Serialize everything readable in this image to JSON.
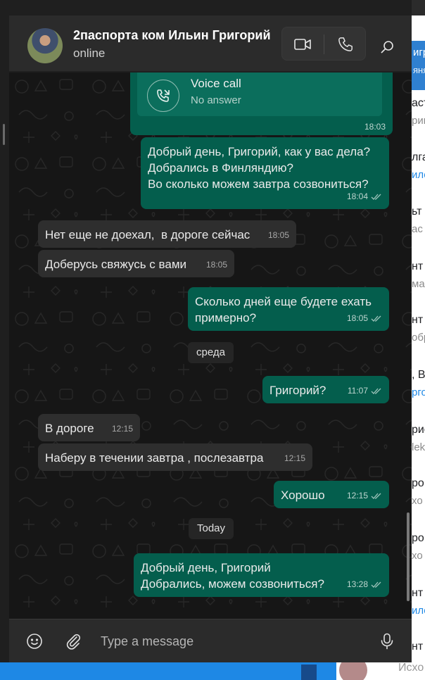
{
  "background_app": {
    "highlight_lines": [
      "игр",
      "яня"
    ],
    "rows": [
      {
        "title": "аст",
        "sub": "рин",
        "sub_blue": false
      },
      {
        "title": "лга",
        "sub": "ило",
        "sub_blue": true
      },
      {
        "title": "ьт",
        "sub": "ас",
        "sub_blue": false
      },
      {
        "title": "нт I",
        "sub": "ма",
        "sub_blue": false
      },
      {
        "title": "нт I",
        "sub": "обр",
        "sub_blue": false
      },
      {
        "title": ", Ві",
        "sub": "рго",
        "sub_blue": true
      },
      {
        "title": "рис",
        "sub": "lek",
        "sub_blue": false
      },
      {
        "title": "ро",
        "sub": "хо",
        "sub_blue": false
      },
      {
        "title": "ро",
        "sub": "хо",
        "sub_blue": false
      },
      {
        "title": "нт I",
        "sub": "ило",
        "sub_blue": true
      },
      {
        "title": "нт I",
        "sub": "",
        "sub_blue": false
      }
    ],
    "bottom_item_text": "Исхо"
  },
  "header": {
    "contact_name": "2паспорта ком Ильин Григорий",
    "status": "online",
    "icons": {
      "video": "video-call-icon",
      "voice": "phone-icon",
      "search": "search-icon"
    }
  },
  "voice_call": {
    "title": "Voice call",
    "subtitle": "No answer",
    "time": "18:03"
  },
  "messages": [
    {
      "dir": "out",
      "text": "Добрый день, Григорий, как у вас дела?\nДобрались в Финляндию?\nВо сколько можем завтра созвониться?",
      "time": "18:04",
      "ticks": true
    },
    {
      "dir": "in",
      "text": "Нет еще не доехал,  в дороге сейчас",
      "time": "18:05",
      "ticks": false
    },
    {
      "dir": "in",
      "text": "Доберусь свяжусь с вами",
      "time": "18:05",
      "ticks": false
    },
    {
      "dir": "out",
      "text": "Сколько дней еще будете ехать\nпримерно?",
      "time": "18:05",
      "ticks": true
    },
    {
      "dir": "out",
      "text": "Григорий?",
      "time": "11:07",
      "ticks": true
    },
    {
      "dir": "in",
      "text": "В дороге",
      "time": "12:15",
      "ticks": false
    },
    {
      "dir": "in",
      "text": "Наберу в течении завтра , послезавтра",
      "time": "12:15",
      "ticks": false
    },
    {
      "dir": "out",
      "text": "Хорошо",
      "time": "12:15",
      "ticks": true
    },
    {
      "dir": "out",
      "text": "Добрый день, Григорий\nДобрались, можем созвониться?",
      "time": "13:28",
      "ticks": true
    }
  ],
  "date_separators": [
    "среда",
    "Today"
  ],
  "composer": {
    "placeholder": "Type a message",
    "icons": {
      "emoji": "emoji-icon",
      "attach": "paperclip-icon",
      "mic": "microphone-icon"
    }
  },
  "colors": {
    "outgoing_bubble": "#045e4d",
    "incoming_bubble": "#2e2e2e",
    "chat_background": "#161616",
    "header": "#2b2b2b",
    "accent_blue": "#1e88e5"
  }
}
